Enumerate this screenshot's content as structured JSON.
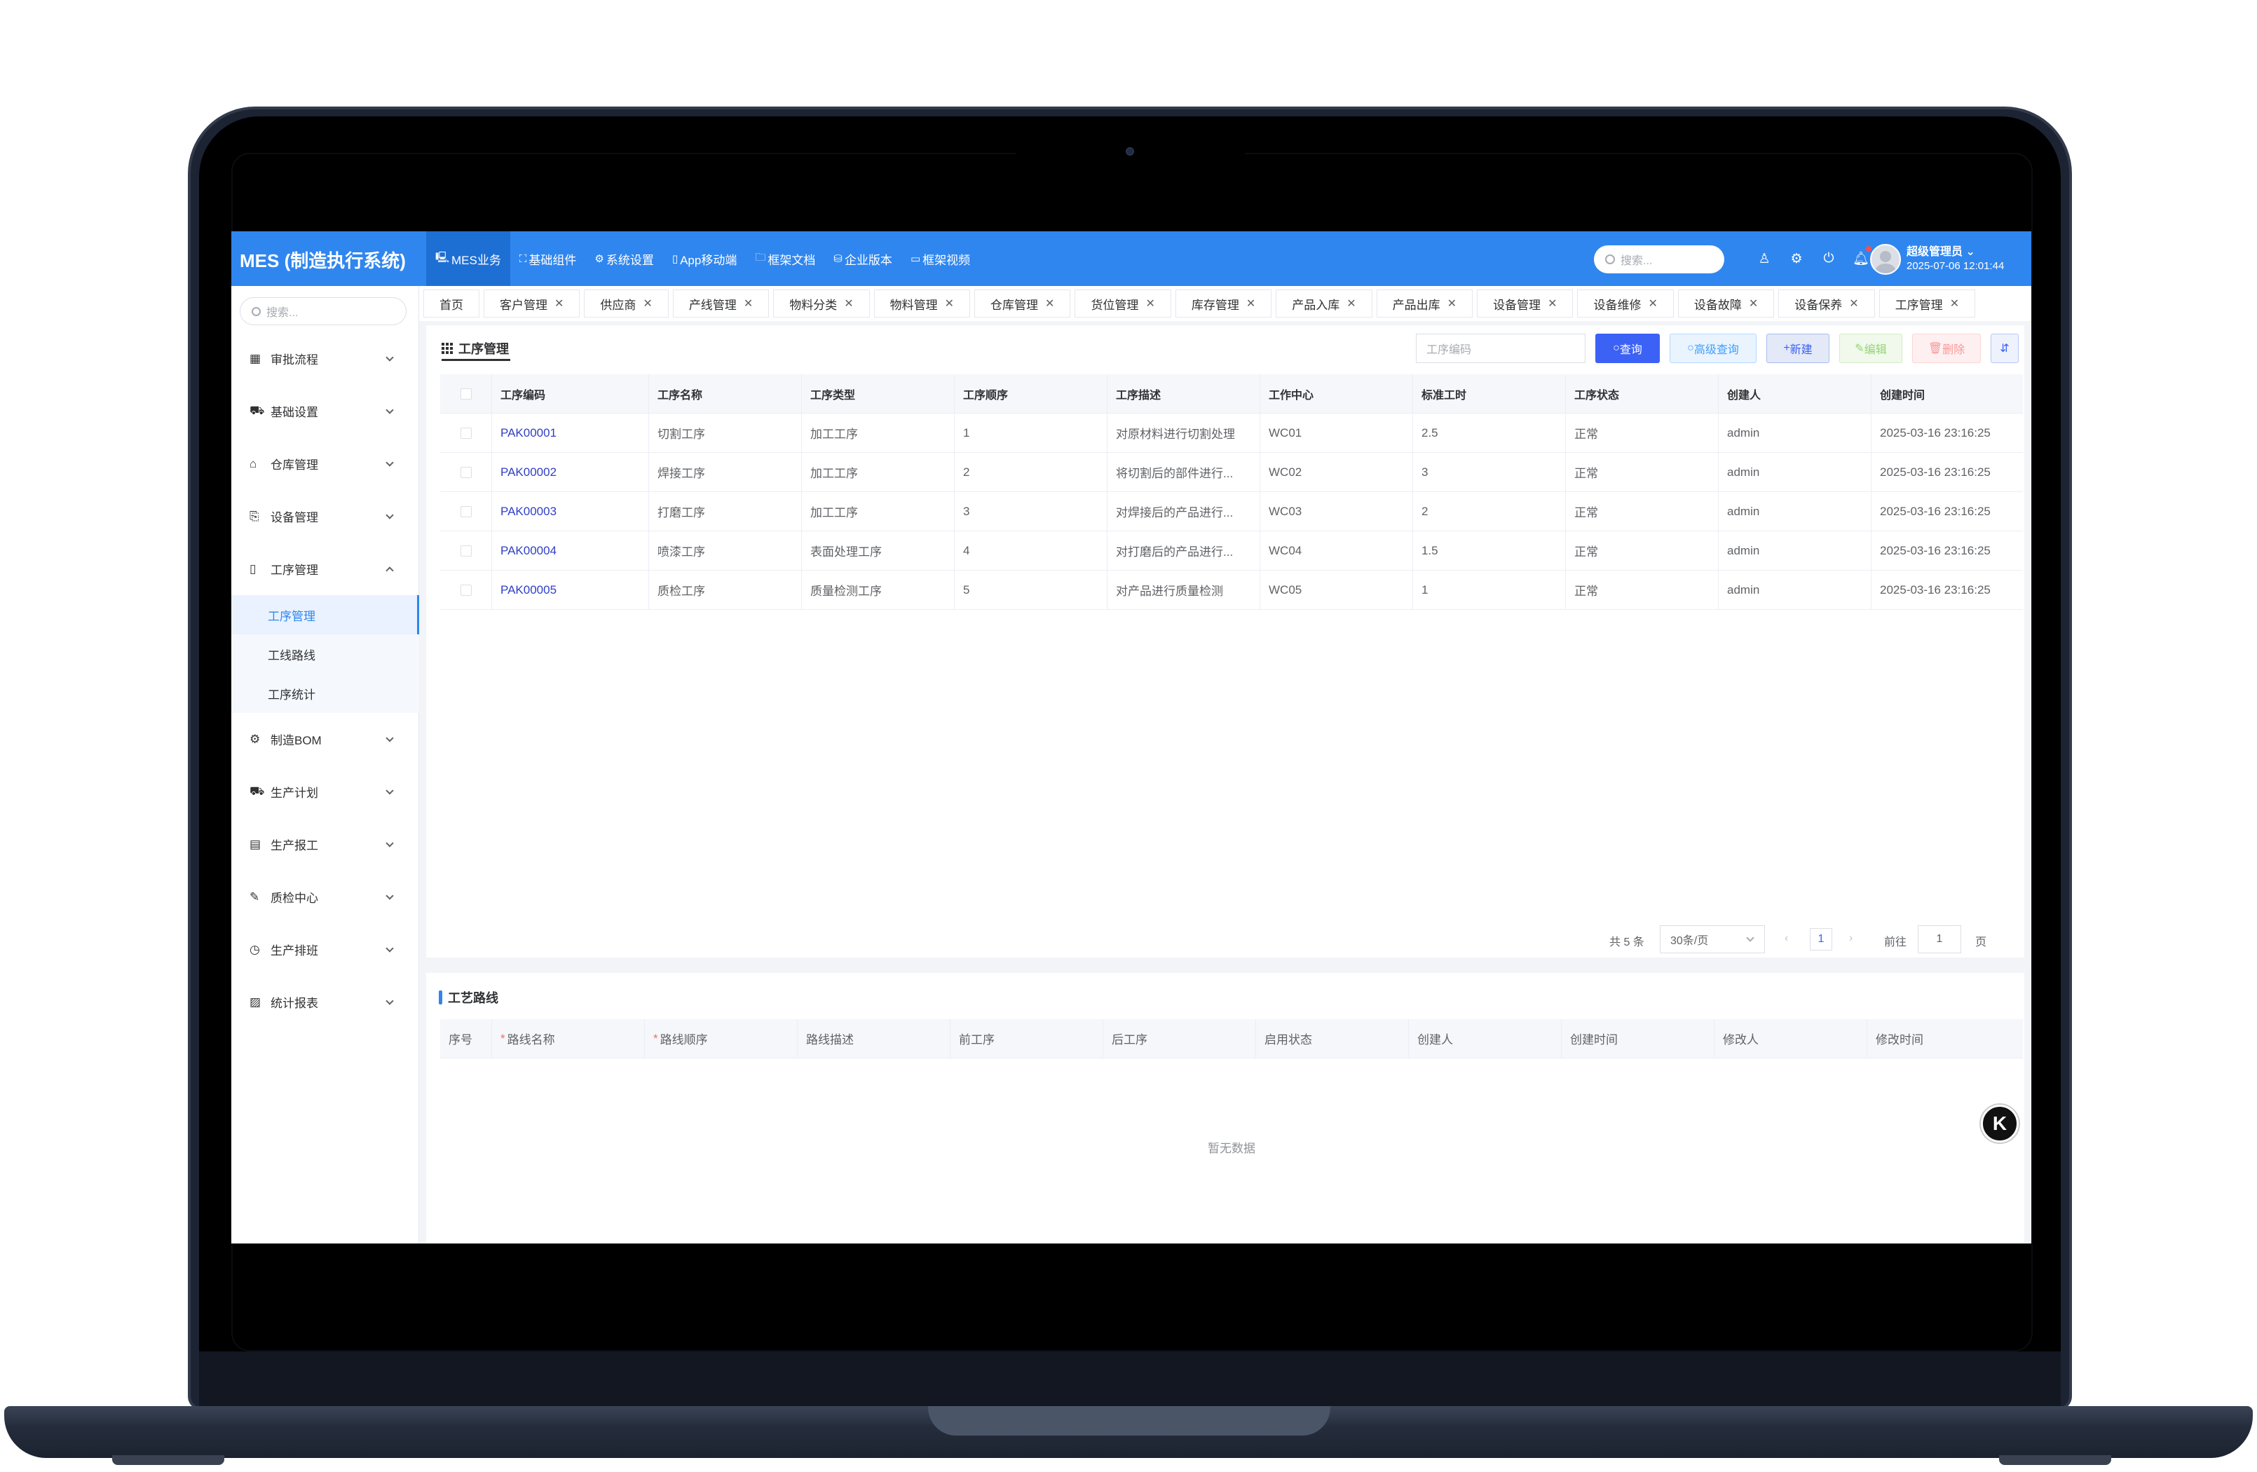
{
  "app": {
    "brand": "MES (制造执行系统)",
    "top_nav": [
      {
        "icon": "monitor-icon",
        "glyph": "🖳",
        "label": "MES业务"
      },
      {
        "icon": "expand-icon",
        "glyph": "⛶",
        "label": "基础组件"
      },
      {
        "icon": "gear-icon",
        "glyph": "⚙",
        "label": "系统设置"
      },
      {
        "icon": "mobile-icon",
        "glyph": "▯",
        "label": "App移动端"
      },
      {
        "icon": "folder-icon",
        "glyph": "🗀",
        "label": "框架文档"
      },
      {
        "icon": "database-icon",
        "glyph": "⛁",
        "label": "企业版本"
      },
      {
        "icon": "video-icon",
        "glyph": "▭",
        "label": "框架视频"
      }
    ],
    "search_placeholder": "搜索...",
    "user": {
      "name": "超级管理员",
      "datetime": "2025-07-06 12:01:44"
    }
  },
  "sidebar": {
    "search_placeholder": "搜索...",
    "menu": [
      {
        "label": "审批流程",
        "icon": "calendar-icon",
        "glyph": "▦"
      },
      {
        "label": "基础设置",
        "icon": "car-icon",
        "glyph": "⛟"
      },
      {
        "label": "仓库管理",
        "icon": "home-icon",
        "glyph": "⌂"
      },
      {
        "label": "设备管理",
        "icon": "share-icon",
        "glyph": "⎘"
      },
      {
        "label": "工序管理",
        "icon": "tablet-icon",
        "glyph": "▯"
      },
      {
        "label": "制造BOM",
        "icon": "settings-icon",
        "glyph": "⚙"
      },
      {
        "label": "生产计划",
        "icon": "cart-icon",
        "glyph": "⛟"
      },
      {
        "label": "生产报工",
        "icon": "document-icon",
        "glyph": "▤"
      },
      {
        "label": "质检中心",
        "icon": "edit-icon",
        "glyph": "✎"
      },
      {
        "label": "生产排班",
        "icon": "clock-icon",
        "glyph": "◷"
      },
      {
        "label": "统计报表",
        "icon": "chart-icon",
        "glyph": "▨"
      }
    ],
    "submenu": [
      "工序管理",
      "工线路线",
      "工序统计"
    ]
  },
  "tabs": [
    "首页",
    "客户管理",
    "供应商",
    "产线管理",
    "物料分类",
    "物料管理",
    "仓库管理",
    "货位管理",
    "库存管理",
    "产品入库",
    "产品出库",
    "设备管理",
    "设备维修",
    "设备故障",
    "设备保养",
    "工序管理"
  ],
  "main": {
    "title": "工序管理",
    "filter_placeholder": "工序编码",
    "buttons": {
      "query": "查询",
      "advanced": "高级查询",
      "new": "新建",
      "edit": "编辑",
      "delete": "删除"
    },
    "columns": [
      "工序编码",
      "工序名称",
      "工序类型",
      "工序顺序",
      "工序描述",
      "工作中心",
      "标准工时",
      "工序状态",
      "创建人",
      "创建时间"
    ],
    "rows": [
      [
        "PAK00001",
        "切割工序",
        "加工工序",
        "1",
        "对原材料进行切割处理",
        "WC01",
        "2.5",
        "正常",
        "admin",
        "2025-03-16 23:16:25"
      ],
      [
        "PAK00002",
        "焊接工序",
        "加工工序",
        "2",
        "将切割后的部件进行...",
        "WC02",
        "3",
        "正常",
        "admin",
        "2025-03-16 23:16:25"
      ],
      [
        "PAK00003",
        "打磨工序",
        "加工工序",
        "3",
        "对焊接后的产品进行...",
        "WC03",
        "2",
        "正常",
        "admin",
        "2025-03-16 23:16:25"
      ],
      [
        "PAK00004",
        "喷漆工序",
        "表面处理工序",
        "4",
        "对打磨后的产品进行...",
        "WC04",
        "1.5",
        "正常",
        "admin",
        "2025-03-16 23:16:25"
      ],
      [
        "PAK00005",
        "质检工序",
        "质量检测工序",
        "5",
        "对产品进行质量检测",
        "WC05",
        "1",
        "正常",
        "admin",
        "2025-03-16 23:16:25"
      ]
    ],
    "pagination": {
      "total": "共 5 条",
      "page_size": "30条/页",
      "current": "1",
      "goto_label": "前往",
      "goto_value": "1",
      "page_unit": "页"
    }
  },
  "route": {
    "title": "工艺路线",
    "columns": [
      "序号",
      "路线名称",
      "路线顺序",
      "路线描述",
      "前工序",
      "后工序",
      "启用状态",
      "创建人",
      "创建时间",
      "修改人",
      "修改时间"
    ],
    "required": [
      false,
      true,
      true,
      false,
      false,
      false,
      false,
      false,
      false,
      false,
      false
    ],
    "empty_text": "暂无数据"
  },
  "float_button": "K"
}
